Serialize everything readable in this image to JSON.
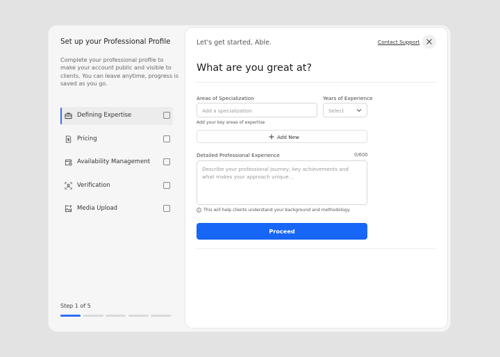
{
  "sidebar": {
    "title": "Set up your Professional Profile",
    "description": "Complete your professional profile to make your account public and visible to clients. You can leave anytime, progress is saved as you go.",
    "steps": [
      {
        "label": "Defining Expertise",
        "icon": "briefcase-icon",
        "active": true
      },
      {
        "label": "Pricing",
        "icon": "dollar-doc-icon",
        "active": false
      },
      {
        "label": "Availability Management",
        "icon": "calendar-clock-icon",
        "active": false
      },
      {
        "label": "Verification",
        "icon": "face-scan-icon",
        "active": false
      },
      {
        "label": "Media Upload",
        "icon": "image-upload-icon",
        "active": false
      }
    ],
    "step_counter": "Step 1 of 5",
    "progress": {
      "current": 1,
      "total": 5
    }
  },
  "header": {
    "greeting": "Let's get started, Able.",
    "contact_support": "Contact Support"
  },
  "form": {
    "heading": "What are you great at?",
    "specialization": {
      "label": "Areas of Specialization",
      "placeholder": "Add a specialization",
      "hint": "Add your key areas of expertise"
    },
    "experience_years": {
      "label": "Years of Experience",
      "placeholder": "Select"
    },
    "add_new_label": "Add New",
    "detailed_experience": {
      "label": "Detailed Professional Experience",
      "counter": "0/600",
      "placeholder": "Describe your professional journey, key achievements and what makes your approach unique...",
      "info": "This will help clients understand your background and methodology."
    },
    "proceed_label": "Proceed"
  },
  "colors": {
    "accent": "#1766f5",
    "progress_done": "#2f6df6",
    "progress_todo": "#d9d9d9"
  }
}
